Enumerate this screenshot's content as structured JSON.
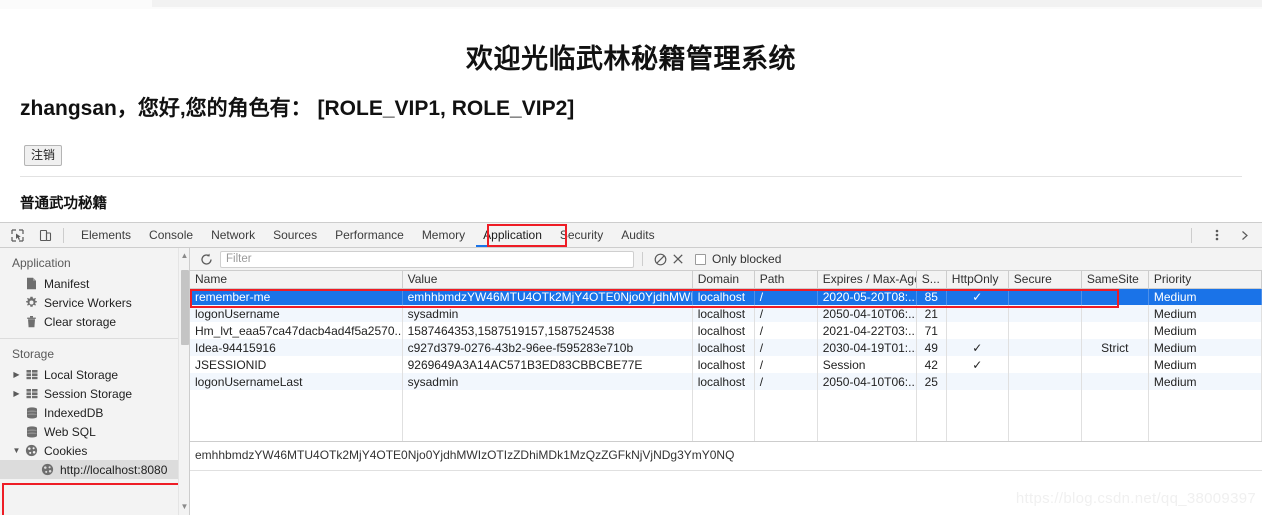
{
  "webpage": {
    "title": "欢迎光临武林秘籍管理系统",
    "greeting": "zhangsan，您好,您的角色有： [ROLE_VIP1, ROLE_VIP2]",
    "logout_label": "注销",
    "section_title": "普通武功秘籍"
  },
  "devtools": {
    "tabs": [
      {
        "label": "Elements",
        "active": false
      },
      {
        "label": "Console",
        "active": false
      },
      {
        "label": "Network",
        "active": false
      },
      {
        "label": "Sources",
        "active": false
      },
      {
        "label": "Performance",
        "active": false
      },
      {
        "label": "Memory",
        "active": false
      },
      {
        "label": "Application",
        "active": true
      },
      {
        "label": "Security",
        "active": false
      },
      {
        "label": "Audits",
        "active": false
      }
    ],
    "highlight_color": "#ee1c25",
    "accent_color": "#1a73e8",
    "sidebar": {
      "application_group": "Application",
      "application_items": [
        {
          "label": "Manifest",
          "icon": "document-icon"
        },
        {
          "label": "Service Workers",
          "icon": "gear-icon"
        },
        {
          "label": "Clear storage",
          "icon": "trash-icon"
        }
      ],
      "storage_group": "Storage",
      "storage_items": [
        {
          "label": "Local Storage",
          "icon": "table-icon",
          "expandable": true,
          "expanded": false
        },
        {
          "label": "Session Storage",
          "icon": "table-icon",
          "expandable": true,
          "expanded": false
        },
        {
          "label": "IndexedDB",
          "icon": "database-icon",
          "expandable": false,
          "expanded": false
        },
        {
          "label": "Web SQL",
          "icon": "database-icon",
          "expandable": false,
          "expanded": false
        },
        {
          "label": "Cookies",
          "icon": "cookie-icon",
          "expandable": true,
          "expanded": true
        }
      ],
      "cookie_origin": "http://localhost:8080"
    },
    "filterbar": {
      "placeholder": "Filter",
      "value": "",
      "only_blocked_label": "Only blocked",
      "only_blocked_checked": false,
      "refresh_icon": "refresh-icon",
      "clear_all_icon": "block-icon",
      "delete_icon": "close-icon"
    },
    "table": {
      "columns": [
        "Name",
        "Value",
        "Domain",
        "Path",
        "Expires / Max-Age",
        "S...",
        "HttpOnly",
        "Secure",
        "SameSite",
        "Priority"
      ],
      "rows": [
        {
          "name": "remember-me",
          "value": "emhhbmdzYW46MTU4OTk2MjY4OTE0Njo0YjdhMWIzOT...",
          "domain": "localhost",
          "path": "/",
          "expires": "2020-05-20T08:...",
          "size": "85",
          "httponly": "✓",
          "secure": "",
          "samesite": "",
          "priority": "Medium",
          "selected": true
        },
        {
          "name": "logonUsername",
          "value": "sysadmin",
          "domain": "localhost",
          "path": "/",
          "expires": "2050-04-10T06:...",
          "size": "21",
          "httponly": "",
          "secure": "",
          "samesite": "",
          "priority": "Medium",
          "selected": false
        },
        {
          "name": "Hm_lvt_eaa57ca47dacb4ad4f5a2570...",
          "value": "1587464353,1587519157,1587524538",
          "domain": "localhost",
          "path": "/",
          "expires": "2021-04-22T03:...",
          "size": "71",
          "httponly": "",
          "secure": "",
          "samesite": "",
          "priority": "Medium",
          "selected": false
        },
        {
          "name": "Idea-94415916",
          "value": "c927d379-0276-43b2-96ee-f595283e710b",
          "domain": "localhost",
          "path": "/",
          "expires": "2030-04-19T01:...",
          "size": "49",
          "httponly": "✓",
          "secure": "",
          "samesite": "Strict",
          "priority": "Medium",
          "selected": false
        },
        {
          "name": "JSESSIONID",
          "value": "9269649A3A14AC571B3ED83CBBCBE77E",
          "domain": "localhost",
          "path": "/",
          "expires": "Session",
          "size": "42",
          "httponly": "✓",
          "secure": "",
          "samesite": "",
          "priority": "Medium",
          "selected": false
        },
        {
          "name": "logonUsernameLast",
          "value": "sysadmin",
          "domain": "localhost",
          "path": "/",
          "expires": "2050-04-10T06:...",
          "size": "25",
          "httponly": "",
          "secure": "",
          "samesite": "",
          "priority": "Medium",
          "selected": false
        }
      ]
    },
    "preview": {
      "value": "emhhbmdzYW46MTU4OTk2MjY4OTE0Njo0YjdhMWIzOTIzZDhiMDk1MzQzZGFkNjVjNDg3YmY0NQ"
    }
  },
  "watermark": "https://blog.csdn.net/qq_38009397"
}
